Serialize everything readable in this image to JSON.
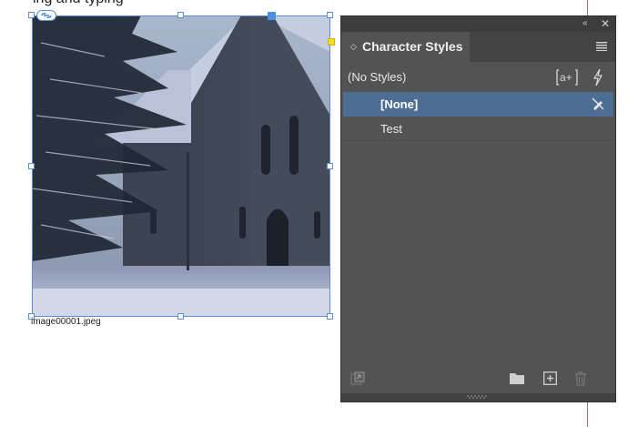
{
  "document": {
    "top_text": "ing and typing",
    "image_caption": "image00001.jpeg"
  },
  "panel": {
    "title": "Character Styles",
    "collapse_icon": "double-chevron-left-icon",
    "close_icon": "close-icon",
    "menu_icon": "hamburger-menu-icon",
    "group_label": "(No Styles)",
    "styles": [
      {
        "label": "[None]",
        "selected": true
      },
      {
        "label": "Test",
        "selected": false
      }
    ],
    "colors": {
      "panel_bg": "#535353",
      "selected_row": "#4e6d93",
      "frame_border": "#5b8fd6"
    }
  }
}
